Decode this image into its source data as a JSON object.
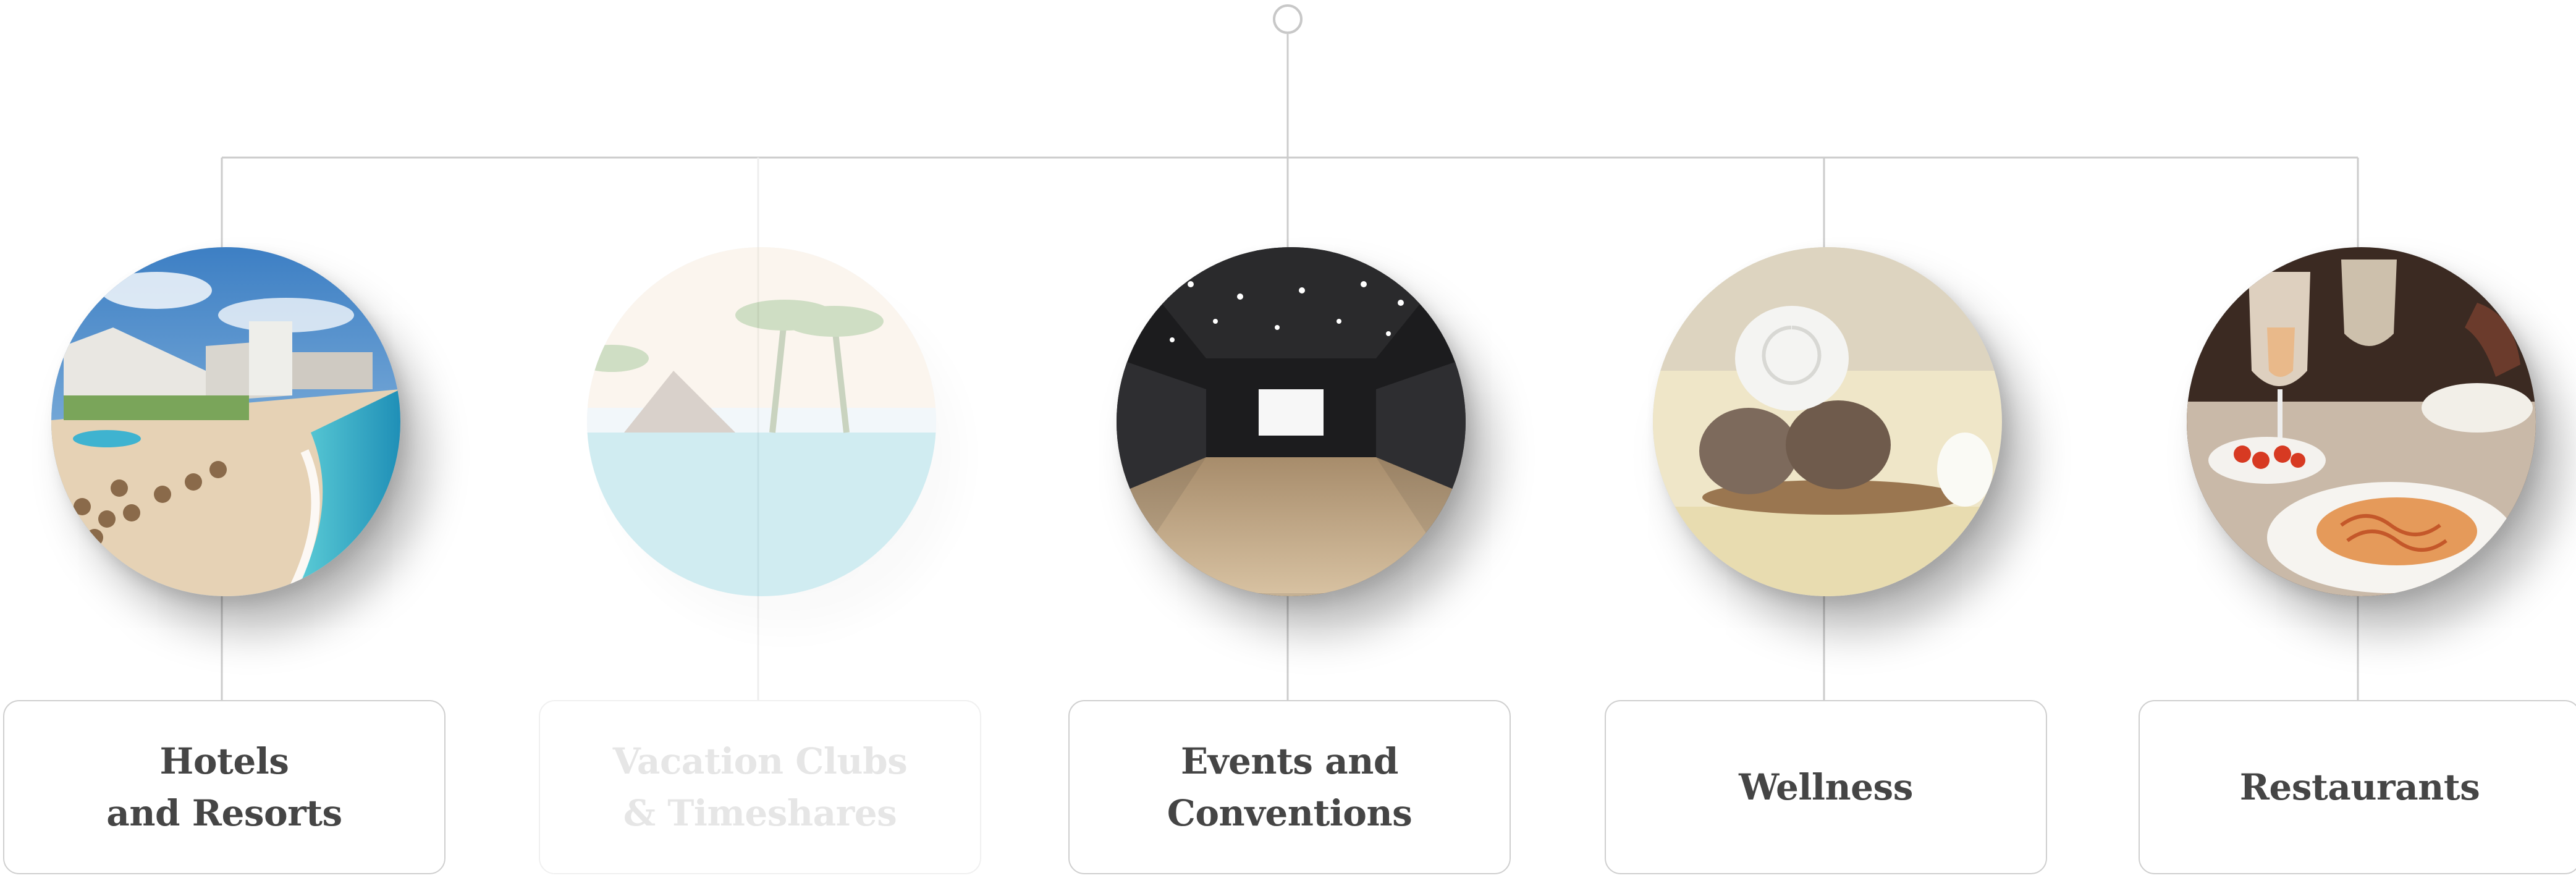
{
  "nodes": [
    {
      "id": "hotels",
      "line1": "Hotels",
      "line2": "and Resorts",
      "state": "active"
    },
    {
      "id": "vacation-clubs",
      "line1": "Vacation Clubs",
      "line2": "& Timeshares",
      "state": "faded"
    },
    {
      "id": "events",
      "line1": "Events and",
      "line2": "Conventions",
      "state": "active"
    },
    {
      "id": "wellness",
      "line1": "Wellness",
      "line2": "",
      "state": "active"
    },
    {
      "id": "restaurants",
      "line1": "Restaurants",
      "line2": "",
      "state": "active"
    }
  ],
  "colors": {
    "line": "#cccccc",
    "faded_line": "#eeeeee",
    "label_text": "#454545",
    "label_border": "#cfcfcf"
  }
}
